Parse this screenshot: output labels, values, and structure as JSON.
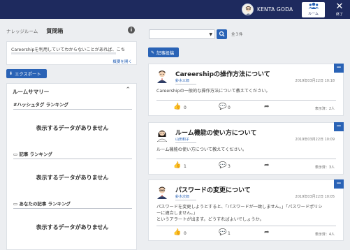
{
  "header": {
    "username": "KENTA GODA",
    "room_label": "ルーム",
    "exit_label": "終了"
  },
  "left": {
    "breadcrumb": "ナレッジルーム",
    "page_title": "質問箱",
    "description": "Careershipを利用していてわからないことがあれば、こち",
    "description_more": "概要を開く",
    "export_label": "エクスポート",
    "summary_title": "ルームサマリー",
    "sections": [
      {
        "heading": "#ハッシュタグ ランキング",
        "empty": "表示するデータがありません"
      },
      {
        "heading": "記事 ランキング",
        "empty": "表示するデータがありません"
      },
      {
        "heading": "あなたの記事 ランキング",
        "empty": "表示するデータがありません"
      }
    ]
  },
  "right": {
    "count_text": "全３件",
    "post_label": "記事投稿",
    "posts": [
      {
        "title": "Careershipの操作方法について",
        "author": "鈴木三郎",
        "date": "2019年03月22日 10:18",
        "body_lines": [
          "Careershipの一般的な操作方法について教えてください。"
        ],
        "likes": "0",
        "comments": "0",
        "views": "表示済：2人"
      },
      {
        "title": "ルーム機能の使い方について",
        "author": "山田和子",
        "date": "2019年03月22日 10:09",
        "body_lines": [
          "ルーム機能の使い方について教えてください。"
        ],
        "likes": "1",
        "comments": "3",
        "views": "表示済：3人"
      },
      {
        "title": "パスワードの変更について",
        "author": "鈴木次郎",
        "date": "2019年03月22日 10:05",
        "body_lines": [
          "パスワードを変更しようとすると、「パスワードが一致しません。」「パスワードポリシ",
          "ーに適合しません。」",
          "というアラートが出ます。どうすればよいでしょうか。"
        ],
        "likes": "0",
        "comments": "1",
        "views": "表示済：4人"
      }
    ]
  },
  "colors": {
    "header_bg": "#1e2a5e",
    "accent": "#2a63b6",
    "page_bg": "#eceef1"
  }
}
